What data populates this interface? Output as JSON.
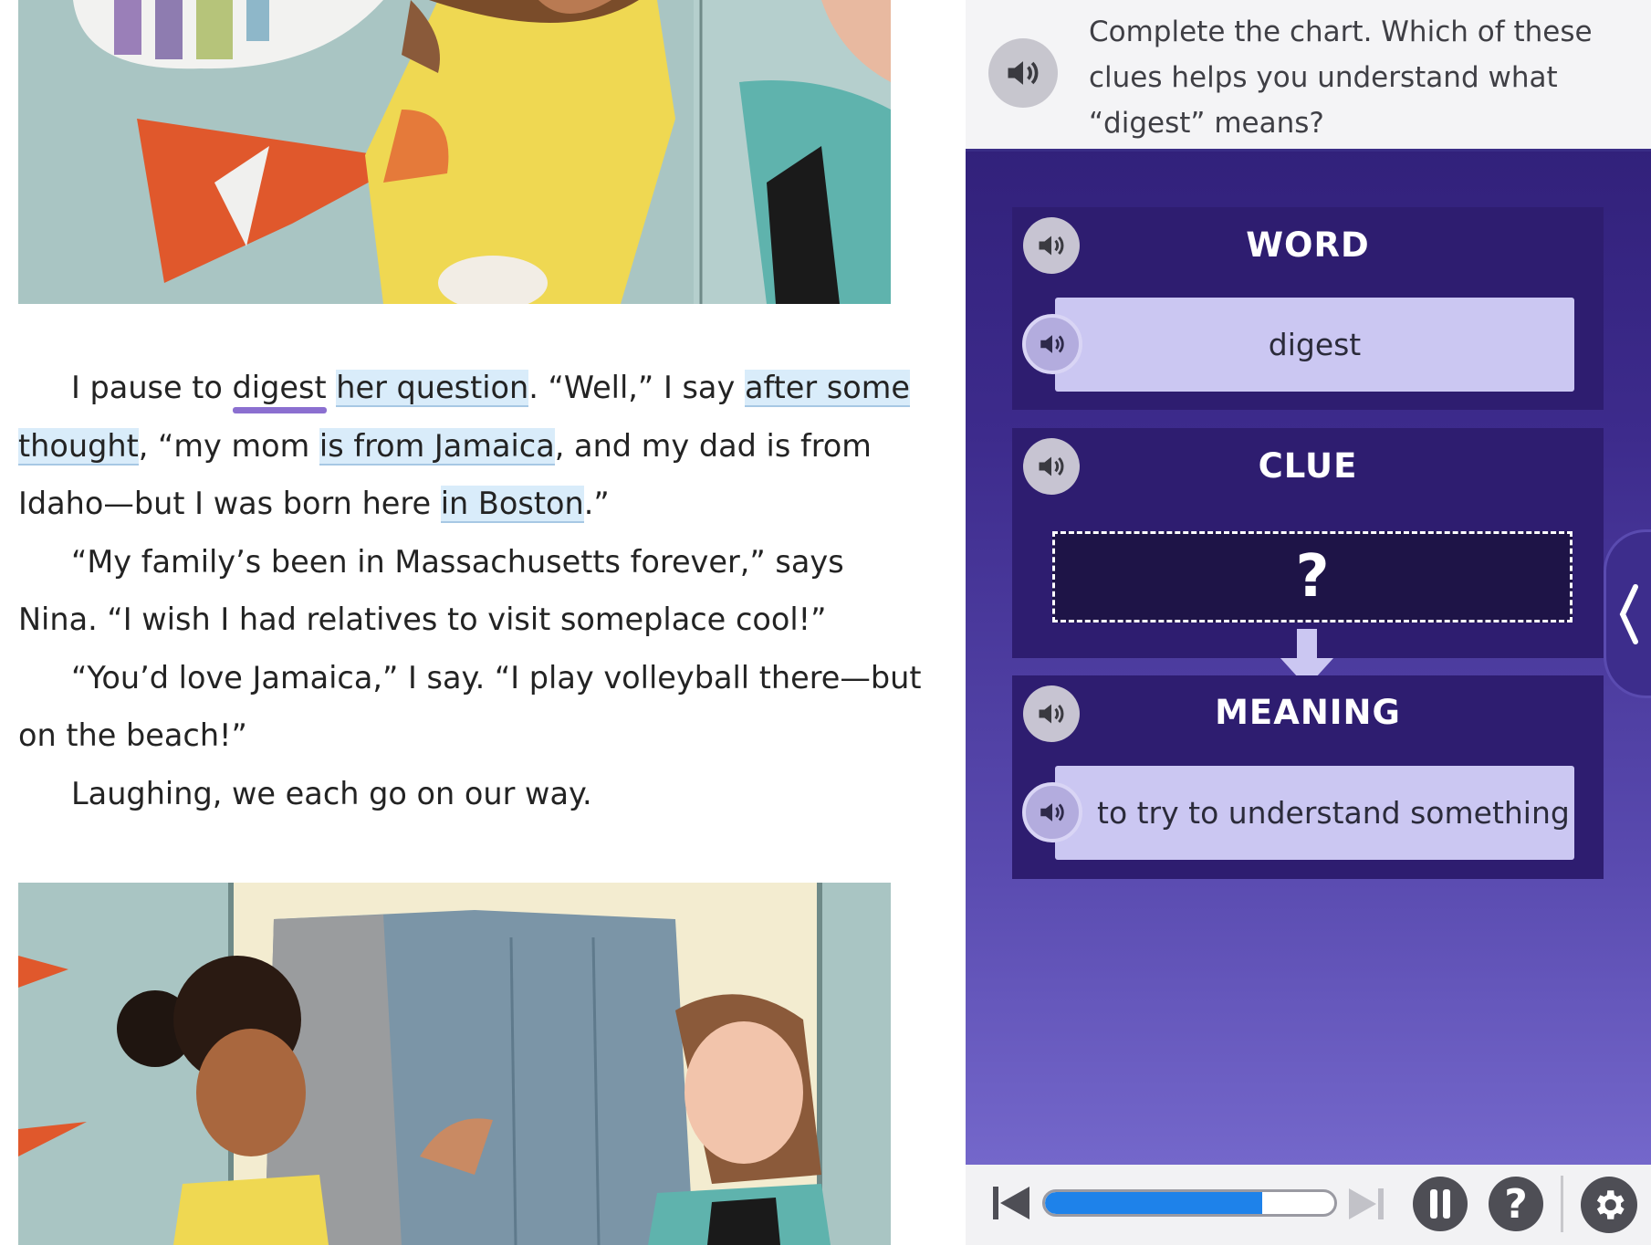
{
  "story": {
    "paragraph1": {
      "t1": "I pause to ",
      "word": "digest",
      "t2": " ",
      "clue1": "her question",
      "t3": ". “Well,” I say ",
      "clue2": "after some thought",
      "t4": ", “my mom ",
      "clue3": "is from Jamaica",
      "t5": ", and my dad is from Idaho—but I was born here ",
      "clue4": "in Boston",
      "t6": ".”"
    },
    "paragraph2": "“My family’s been in Massachusetts forever,” says Nina. “I wish I had relatives to visit someplace cool!”",
    "paragraph3": "“You’d love Jamaica,” I say. “I play volleyball there—but on the beach!”",
    "paragraph4": "Laughing, we each go on our way."
  },
  "activity": {
    "prompt": "Complete the chart. Which of these clues helps you understand what “digest” means?",
    "word": {
      "title": "WORD",
      "value": "digest"
    },
    "clue": {
      "title": "CLUE",
      "placeholder": "?"
    },
    "meaning": {
      "title": "MEANING",
      "value": "to try to understand something"
    }
  },
  "toolbar": {
    "progress_fraction": 0.75,
    "help_label": "?"
  },
  "colors": {
    "panel_dark": "#2e1d70",
    "card": "#cbc7f2",
    "progress": "#1e82ea",
    "highlight": "#d9ecfa",
    "underline": "#8b6fd0"
  },
  "icons": [
    "speaker-icon",
    "skip-back-icon",
    "skip-forward-icon",
    "pause-icon",
    "help-icon",
    "gear-icon",
    "chevron-left-icon",
    "down-arrow-icon"
  ]
}
